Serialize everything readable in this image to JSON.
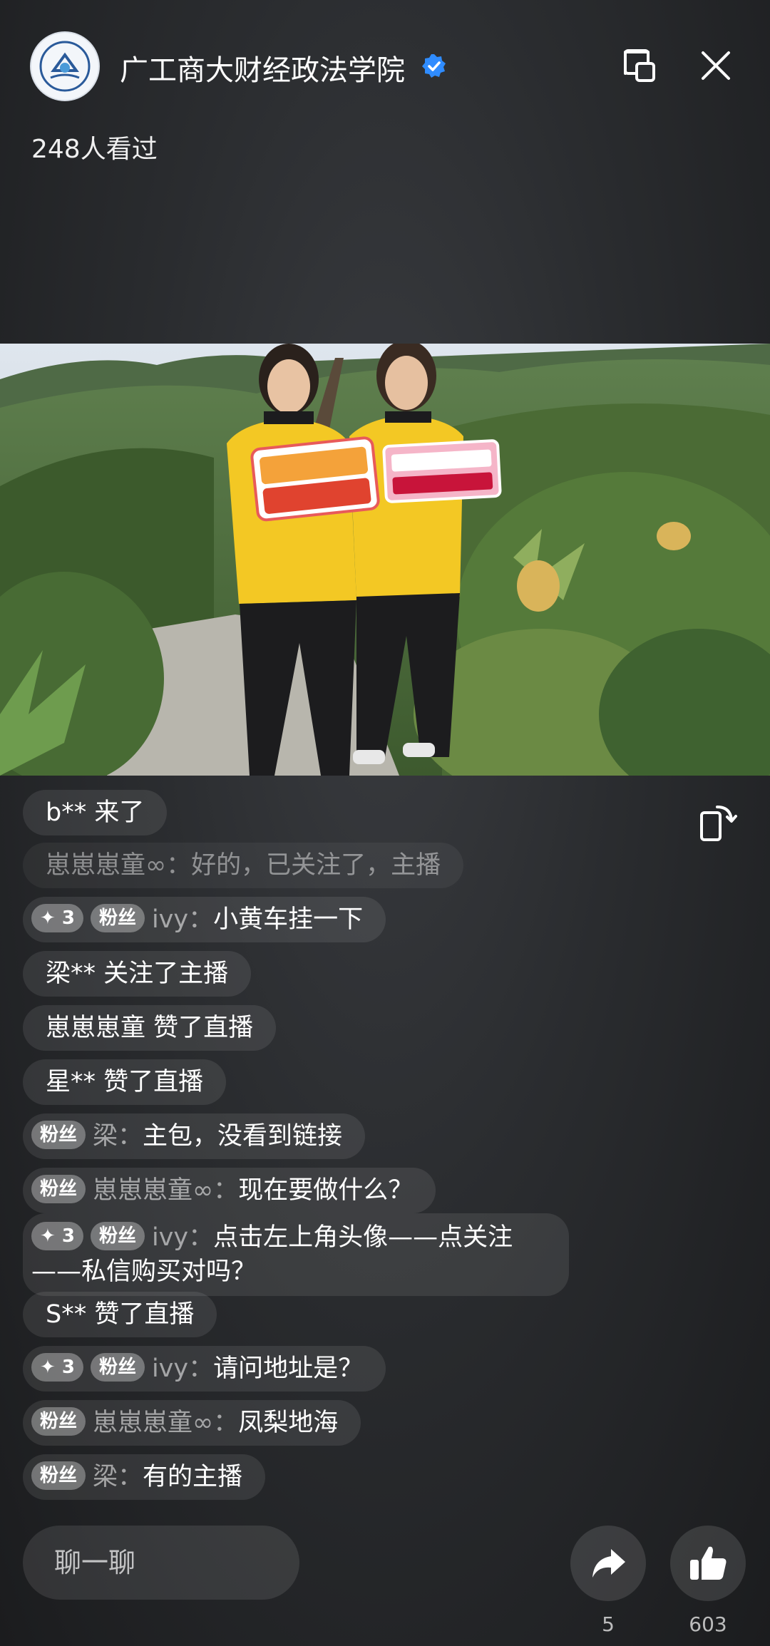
{
  "header": {
    "title": "广工商大财经政法学院",
    "viewers": "248人看过"
  },
  "chat": {
    "messages": [
      {
        "user": "b**",
        "text": "来了",
        "badges": []
      },
      {
        "user": "崽崽崽童",
        "text": "好的，已关注了，主播",
        "badges": []
      },
      {
        "user": "ivy",
        "text": "小黄车挂一下",
        "badges": [
          "✦ 3",
          "粉丝"
        ]
      },
      {
        "user": "梁**",
        "text": "关注了主播",
        "badges": []
      },
      {
        "user": "崽崽崽童",
        "text": "赞了直播",
        "badges": []
      },
      {
        "user": "星**",
        "text": "赞了直播",
        "badges": []
      },
      {
        "user": "梁",
        "text": "主包，没看到链接",
        "badges": [
          "粉丝"
        ]
      },
      {
        "user": "崽崽崽童",
        "text": "现在要做什么？",
        "badges": [
          "粉丝"
        ]
      },
      {
        "user": "ivy",
        "text": "点击左上角头像——点关注——私信购买对吗？",
        "badges": [
          "✦ 3",
          "粉丝"
        ]
      },
      {
        "user": "S**",
        "text": "赞了直播",
        "badges": []
      },
      {
        "user": "ivy",
        "text": "请问地址是？",
        "badges": [
          "✦ 3",
          "粉丝"
        ]
      },
      {
        "user": "崽崽崽童",
        "text": "凤梨地海",
        "badges": [
          "粉丝"
        ]
      },
      {
        "user": "梁",
        "text": "有的主播",
        "badges": [
          "粉丝"
        ]
      }
    ]
  },
  "bottom": {
    "input_placeholder": "聊一聊",
    "share_count": "5",
    "like_count": "603"
  },
  "colors": {
    "verified": "#2f8cff",
    "shirt": "#f3c824"
  },
  "icons": [
    "verified-icon",
    "pip-icon",
    "close-icon",
    "rotate-icon",
    "share-icon",
    "like-icon"
  ]
}
